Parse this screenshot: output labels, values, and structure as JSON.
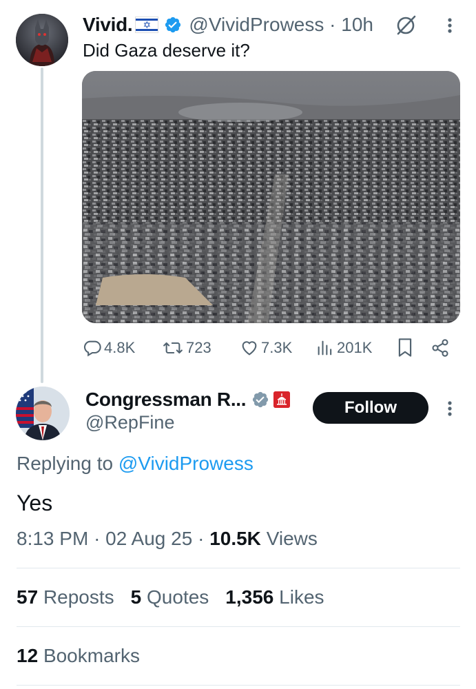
{
  "parent_tweet": {
    "display_name": "Vivid.",
    "flag": "Israel flag",
    "handle": "@VividProwess",
    "separator": " · ",
    "time": "10h",
    "text": "Did Gaza deserve it?",
    "media_description": "aerial photo of destroyed city",
    "actions": {
      "replies": "4.8K",
      "reposts": "723",
      "likes": "7.3K",
      "views": "201K"
    }
  },
  "reply_tweet": {
    "display_name": "Congressman R...",
    "handle": "@RepFine",
    "follow_label": "Follow",
    "replying_prefix": "Replying to ",
    "replying_to": "@VividProwess",
    "text": "Yes",
    "time": "8:13 PM",
    "date": "02 Aug 25",
    "views_count": "10.5K",
    "views_label": "Views",
    "stats": {
      "reposts_count": "57",
      "reposts_label": "Reposts",
      "quotes_count": "5",
      "quotes_label": "Quotes",
      "likes_count": "1,356",
      "likes_label": "Likes",
      "bookmarks_count": "12",
      "bookmarks_label": "Bookmarks"
    }
  },
  "colors": {
    "text": "#0f1419",
    "secondary": "#536471",
    "accent": "#1d9bf0",
    "verified_blue": "#1d9bf0",
    "verified_gray": "#829aab",
    "divider": "#e1e8ed"
  },
  "icons": {
    "reply": "reply-icon",
    "repost": "repost-icon",
    "like": "heart-icon",
    "views": "views-chart-icon",
    "bookmark": "bookmark-icon",
    "share": "share-icon",
    "grok": "grok-icon",
    "more": "more-vertical-icon"
  }
}
